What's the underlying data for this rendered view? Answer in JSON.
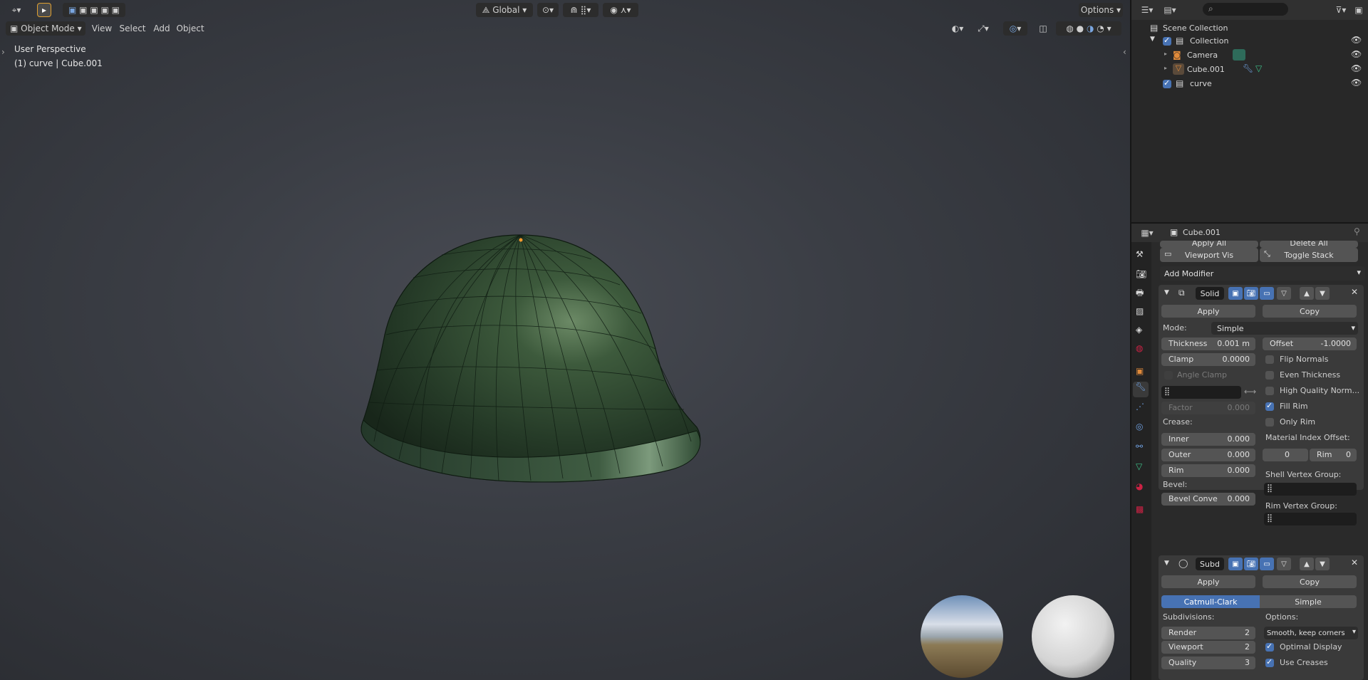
{
  "viewport": {
    "header": {
      "orientation": "Global",
      "options": "Options",
      "mode": "Object Mode",
      "menus": [
        "View",
        "Select",
        "Add",
        "Object"
      ]
    },
    "overlay_text": {
      "perspective": "User Perspective",
      "object_info": "(1) curve | Cube.001"
    }
  },
  "outliner": {
    "search_placeholder": "",
    "scene_collection": "Scene Collection",
    "items": [
      {
        "label": "Collection",
        "icon": "collection-icon",
        "checked": true
      },
      {
        "label": "Camera",
        "icon": "camera-icon"
      },
      {
        "label": "Cube.001",
        "icon": "mesh-icon"
      },
      {
        "label": "curve",
        "icon": "collection-icon",
        "checked": true
      }
    ]
  },
  "properties": {
    "object_name": "Cube.001",
    "top_row": {
      "apply_all": "Apply All",
      "delete_all": "Delete All",
      "viewport_vis": "Viewport Vis",
      "toggle_stack": "Toggle Stack"
    },
    "add_modifier": "Add Modifier",
    "solidify": {
      "name": "Solid",
      "apply": "Apply",
      "copy": "Copy",
      "mode_label": "Mode:",
      "mode_value": "Simple",
      "thickness_label": "Thickness",
      "thickness_value": "0.001 m",
      "offset_label": "Offset",
      "offset_value": "-1.0000",
      "clamp_label": "Clamp",
      "clamp_value": "0.0000",
      "angle_clamp": "Angle Clamp",
      "flip_normals": "Flip Normals",
      "even_thickness": "Even Thickness",
      "high_quality": "High Quality Norm...",
      "fill_rim": "Fill Rim",
      "only_rim": "Only Rim",
      "factor_label": "Factor",
      "factor_value": "0.000",
      "crease_label": "Crease:",
      "inner_label": "Inner",
      "inner_value": "0.000",
      "outer_label": "Outer",
      "outer_value": "0.000",
      "rim_label": "Rim",
      "rim_value": "0.000",
      "material_index_label": "Material Index Offset:",
      "mat_offset_value": "0",
      "mat_rim_label": "Rim",
      "mat_rim_value": "0",
      "bevel_label": "Bevel:",
      "bevel_conv_label": "Bevel Conve",
      "bevel_conv_value": "0.000",
      "shell_vg_label": "Shell Vertex Group:",
      "rim_vg_label": "Rim Vertex Group:"
    },
    "subsurf": {
      "name": "Subd",
      "apply": "Apply",
      "copy": "Copy",
      "catmull": "Catmull-Clark",
      "simple": "Simple",
      "subdivisions_label": "Subdivisions:",
      "options_label": "Options:",
      "render_label": "Render",
      "render_value": "2",
      "viewport_label": "Viewport",
      "viewport_value": "2",
      "quality_label": "Quality",
      "quality_value": "3",
      "uv_smooth": "Smooth, keep corners",
      "optimal_display": "Optimal Display",
      "use_creases": "Use Creases"
    }
  }
}
